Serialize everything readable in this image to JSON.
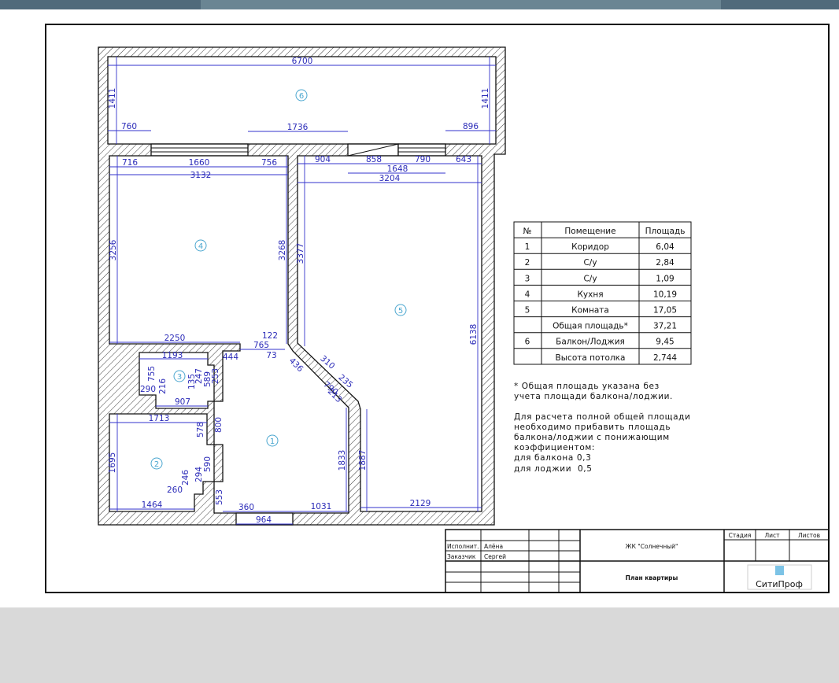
{
  "plan": {
    "rooms": {
      "r1": "1",
      "r2": "2",
      "r3": "3",
      "r4": "4",
      "r5": "5",
      "r6": "6"
    },
    "dims": {
      "balcony_width": "6700",
      "balcony_left_depth": "1411",
      "balcony_right_depth": "1411",
      "balcony_760": "760",
      "balcony_1736": "1736",
      "balcony_896": "896",
      "kitchen_716": "716",
      "kitchen_1660": "1660",
      "kitchen_756": "756",
      "kitchen_3132": "3132",
      "kitchen_3256": "3256",
      "kitchen_3268": "3268",
      "kitchen_2250": "2250",
      "room5_904": "904",
      "room5_858": "858",
      "room5_790": "790",
      "room5_643": "643",
      "room5_1648": "1648",
      "room5_3204": "3204",
      "room5_3377": "3377",
      "room5_6138": "6138",
      "room5_2129": "2129",
      "room5_1887": "1887",
      "cor_122": "122",
      "cor_765": "765",
      "cor_73": "73",
      "cor_436": "436",
      "cor_310": "310",
      "cor_235": "235",
      "cor_790": "790",
      "cor_213": "213",
      "cor_1833": "1833",
      "cor_1031": "1031",
      "cor_360": "360",
      "cor_964": "964",
      "cor_553": "553",
      "cor_590": "590",
      "cor_800": "800",
      "b3_1193": "1193",
      "b3_444": "444",
      "b3_755": "755",
      "b3_216": "216",
      "b3_290": "290",
      "b3_135": "135",
      "b3_247": "247",
      "b3_589": "589",
      "b3_253": "253",
      "b3_907": "907",
      "b2_1713": "1713",
      "b2_578": "578",
      "b2_1695": "1695",
      "b2_294": "294",
      "b2_246": "246",
      "b2_260": "260",
      "b2_1464": "1464"
    }
  },
  "area_table": {
    "headers": [
      "№",
      "Помещение",
      "Площадь"
    ],
    "rows": [
      [
        "1",
        "Коридор",
        "6,04"
      ],
      [
        "2",
        "С/у",
        "2,84"
      ],
      [
        "3",
        "С/у",
        "1,09"
      ],
      [
        "4",
        "Кухня",
        "10,19"
      ],
      [
        "5",
        "Комната",
        "17,05"
      ],
      [
        "",
        "Общая площадь*",
        "37,21"
      ],
      [
        "6",
        "Балкон/Лоджия",
        "9,45"
      ],
      [
        "",
        "Высота потолка",
        "2,744"
      ]
    ]
  },
  "notes": {
    "footnote": [
      "* Общая площадь указана без",
      "учета площади балкона/лоджии."
    ],
    "calc": [
      "Для расчета полной общей площади",
      "необходимо прибавить площадь",
      "балкона/лоджии с понижающим",
      "коэффициентом:",
      "для балкона 0,3",
      "для лоджии  0,5"
    ]
  },
  "title_block": {
    "executor_label": "Исполнит.",
    "executor": "Алёна",
    "customer_label": "Заказчик",
    "customer": "Сергей",
    "project": "ЖК \"Солнечный\"",
    "sheet_title": "План квартиры",
    "stage_label": "Стадия",
    "sheet_label": "Лист",
    "sheets_label": "Листов",
    "logo_text": "СитиПроф"
  },
  "colors": {
    "dimension": "#2b2bb8",
    "room_marker": "#4aa6cf",
    "wall": "#111111",
    "logo": "#5fb3d9"
  }
}
